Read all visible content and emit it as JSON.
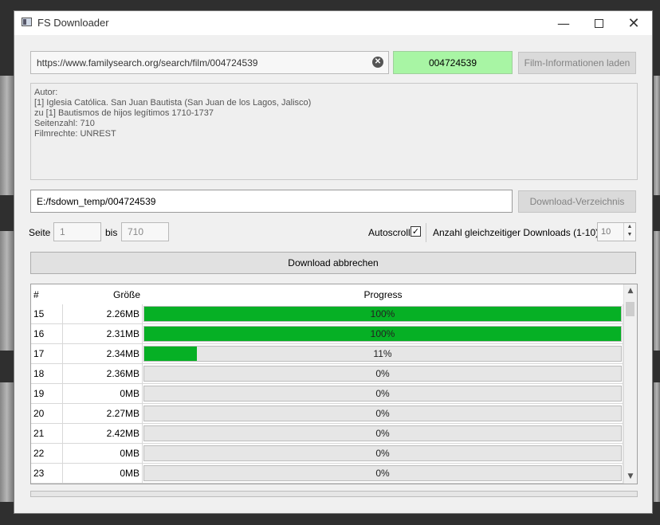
{
  "window": {
    "title": "FS Downloader"
  },
  "url_field": {
    "value": "https://www.familysearch.org/search/film/004724539"
  },
  "film_id": {
    "value": "004724539",
    "color": "#a8f5a4"
  },
  "buttons": {
    "load_info": "Film-Informationen laden",
    "download_dir": "Download-Verzeichnis",
    "cancel_download": "Download abbrechen"
  },
  "info": {
    "lines": [
      "Autor:",
      "[1] Iglesia Católica. San Juan Bautista (San Juan de los Lagos, Jalisco)",
      "zu [1] Bautismos de hijos legítimos 1710-1737",
      "Seitenzahl: 710",
      "Filmrechte: UNREST"
    ]
  },
  "path_field": {
    "value": "E:/fsdown_temp/004724539"
  },
  "pages": {
    "label_from": "Seite",
    "from": "1",
    "label_to": "bis",
    "to": "710"
  },
  "autoscroll": {
    "label": "Autoscroll",
    "checked": true
  },
  "concurrent": {
    "label": "Anzahl gleichzeitiger Downloads (1-10)",
    "value": "10"
  },
  "table": {
    "headers": [
      "#",
      "Größe",
      "Progress"
    ],
    "rows": [
      {
        "num": "15",
        "size": "2.26MB",
        "progress": 100,
        "label": "100%"
      },
      {
        "num": "16",
        "size": "2.31MB",
        "progress": 100,
        "label": "100%"
      },
      {
        "num": "17",
        "size": "2.34MB",
        "progress": 11,
        "label": "11%"
      },
      {
        "num": "18",
        "size": "2.36MB",
        "progress": 0,
        "label": "0%"
      },
      {
        "num": "19",
        "size": "0MB",
        "progress": 0,
        "label": "0%"
      },
      {
        "num": "20",
        "size": "2.27MB",
        "progress": 0,
        "label": "0%"
      },
      {
        "num": "21",
        "size": "2.42MB",
        "progress": 0,
        "label": "0%"
      },
      {
        "num": "22",
        "size": "0MB",
        "progress": 0,
        "label": "0%"
      },
      {
        "num": "23",
        "size": "0MB",
        "progress": 0,
        "label": "0%"
      }
    ]
  },
  "icons": {
    "app": "app-icon",
    "minimize": "minimize-icon",
    "maximize": "maximize-icon",
    "close": "close-icon",
    "clear": "clear-icon",
    "check": "check-icon"
  },
  "colors": {
    "progress_green": "#06b025"
  }
}
